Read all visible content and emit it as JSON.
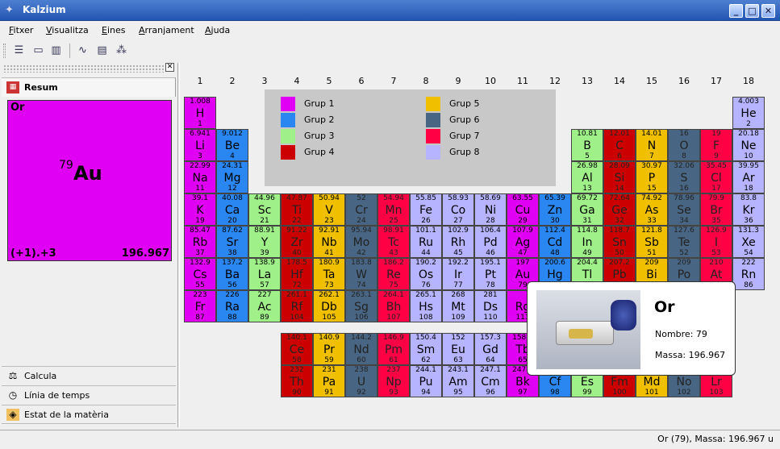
{
  "window": {
    "title": "Kalzium"
  },
  "menu": [
    "Fitxer",
    "Visualitza",
    "Eines",
    "Arranjament",
    "Ajuda"
  ],
  "toolbar": {
    "icons": [
      "list-icon",
      "card-icon",
      "column-icon",
      "wave-icon",
      "notebook-icon",
      "molecule-icon"
    ]
  },
  "sidebar": {
    "summary_tab": "Resum",
    "calc_tab": "Calcula",
    "timeline_tab": "Línia de temps",
    "state_tab": "Estat de la matèria"
  },
  "summary": {
    "name": "Or",
    "number": "79",
    "symbol": "Au",
    "oxidation": "(+1).+3",
    "mass": "196.967"
  },
  "groups": [
    "1",
    "2",
    "3",
    "4",
    "5",
    "6",
    "7",
    "8",
    "9",
    "10",
    "11",
    "12",
    "13",
    "14",
    "15",
    "16",
    "17",
    "18"
  ],
  "legend": [
    "Grup 1",
    "Grup 2",
    "Grup 3",
    "Grup 4",
    "Grup 5",
    "Grup 6",
    "Grup 7",
    "Grup 8"
  ],
  "group_colors": {
    "1": "#e000f4",
    "2": "#2a86f0",
    "3": "#a0f08a",
    "4": "#cc0000",
    "5": "#f0c000",
    "6": "#486683",
    "7": "#ff0044",
    "8": "#b7b4ff"
  },
  "elements": [
    {
      "s": "H",
      "n": "1",
      "m": "1.008",
      "g": "1",
      "x": 1,
      "y": 1
    },
    {
      "s": "He",
      "n": "2",
      "m": "4.003",
      "g": "8",
      "x": 18,
      "y": 1
    },
    {
      "s": "Li",
      "n": "3",
      "m": "6.941",
      "g": "1",
      "x": 1,
      "y": 2
    },
    {
      "s": "Be",
      "n": "4",
      "m": "9.012",
      "g": "2",
      "x": 2,
      "y": 2
    },
    {
      "s": "B",
      "n": "5",
      "m": "10.81",
      "g": "3",
      "x": 13,
      "y": 2
    },
    {
      "s": "C",
      "n": "6",
      "m": "12.01",
      "g": "4",
      "x": 14,
      "y": 2
    },
    {
      "s": "N",
      "n": "7",
      "m": "14.01",
      "g": "5",
      "x": 15,
      "y": 2
    },
    {
      "s": "O",
      "n": "8",
      "m": "16",
      "g": "6",
      "x": 16,
      "y": 2
    },
    {
      "s": "F",
      "n": "9",
      "m": "19",
      "g": "7",
      "x": 17,
      "y": 2
    },
    {
      "s": "Ne",
      "n": "10",
      "m": "20.18",
      "g": "8",
      "x": 18,
      "y": 2
    },
    {
      "s": "Na",
      "n": "11",
      "m": "22.99",
      "g": "1",
      "x": 1,
      "y": 3
    },
    {
      "s": "Mg",
      "n": "12",
      "m": "24.31",
      "g": "2",
      "x": 2,
      "y": 3
    },
    {
      "s": "Al",
      "n": "13",
      "m": "26.98",
      "g": "3",
      "x": 13,
      "y": 3
    },
    {
      "s": "Si",
      "n": "14",
      "m": "28.09",
      "g": "4",
      "x": 14,
      "y": 3
    },
    {
      "s": "P",
      "n": "15",
      "m": "30.97",
      "g": "5",
      "x": 15,
      "y": 3
    },
    {
      "s": "S",
      "n": "16",
      "m": "32.06",
      "g": "6",
      "x": 16,
      "y": 3
    },
    {
      "s": "Cl",
      "n": "17",
      "m": "35.45",
      "g": "7",
      "x": 17,
      "y": 3
    },
    {
      "s": "Ar",
      "n": "18",
      "m": "39.95",
      "g": "8",
      "x": 18,
      "y": 3
    },
    {
      "s": "K",
      "n": "19",
      "m": "39.1",
      "g": "1",
      "x": 1,
      "y": 4
    },
    {
      "s": "Ca",
      "n": "20",
      "m": "40.08",
      "g": "2",
      "x": 2,
      "y": 4
    },
    {
      "s": "Sc",
      "n": "21",
      "m": "44.96",
      "g": "3",
      "x": 3,
      "y": 4
    },
    {
      "s": "Ti",
      "n": "22",
      "m": "47.87",
      "g": "4",
      "x": 4,
      "y": 4
    },
    {
      "s": "V",
      "n": "23",
      "m": "50.94",
      "g": "5",
      "x": 5,
      "y": 4
    },
    {
      "s": "Cr",
      "n": "24",
      "m": "52",
      "g": "6",
      "x": 6,
      "y": 4
    },
    {
      "s": "Mn",
      "n": "25",
      "m": "54.94",
      "g": "7",
      "x": 7,
      "y": 4
    },
    {
      "s": "Fe",
      "n": "26",
      "m": "55.85",
      "g": "8",
      "x": 8,
      "y": 4
    },
    {
      "s": "Co",
      "n": "27",
      "m": "58.93",
      "g": "8",
      "x": 9,
      "y": 4
    },
    {
      "s": "Ni",
      "n": "28",
      "m": "58.69",
      "g": "8",
      "x": 10,
      "y": 4
    },
    {
      "s": "Cu",
      "n": "29",
      "m": "63.55",
      "g": "1",
      "x": 11,
      "y": 4
    },
    {
      "s": "Zn",
      "n": "30",
      "m": "65.39",
      "g": "2",
      "x": 12,
      "y": 4
    },
    {
      "s": "Ga",
      "n": "31",
      "m": "69.72",
      "g": "3",
      "x": 13,
      "y": 4
    },
    {
      "s": "Ge",
      "n": "32",
      "m": "72.64",
      "g": "4",
      "x": 14,
      "y": 4
    },
    {
      "s": "As",
      "n": "33",
      "m": "74.92",
      "g": "5",
      "x": 15,
      "y": 4
    },
    {
      "s": "Se",
      "n": "34",
      "m": "78.96",
      "g": "6",
      "x": 16,
      "y": 4
    },
    {
      "s": "Br",
      "n": "35",
      "m": "79.9",
      "g": "7",
      "x": 17,
      "y": 4
    },
    {
      "s": "Kr",
      "n": "36",
      "m": "83.8",
      "g": "8",
      "x": 18,
      "y": 4
    },
    {
      "s": "Rb",
      "n": "37",
      "m": "85.47",
      "g": "1",
      "x": 1,
      "y": 5
    },
    {
      "s": "Sr",
      "n": "38",
      "m": "87.62",
      "g": "2",
      "x": 2,
      "y": 5
    },
    {
      "s": "Y",
      "n": "39",
      "m": "88.91",
      "g": "3",
      "x": 3,
      "y": 5
    },
    {
      "s": "Zr",
      "n": "40",
      "m": "91.22",
      "g": "4",
      "x": 4,
      "y": 5
    },
    {
      "s": "Nb",
      "n": "41",
      "m": "92.91",
      "g": "5",
      "x": 5,
      "y": 5
    },
    {
      "s": "Mo",
      "n": "42",
      "m": "95.94",
      "g": "6",
      "x": 6,
      "y": 5
    },
    {
      "s": "Tc",
      "n": "43",
      "m": "98.91",
      "g": "7",
      "x": 7,
      "y": 5
    },
    {
      "s": "Ru",
      "n": "44",
      "m": "101.1",
      "g": "8",
      "x": 8,
      "y": 5
    },
    {
      "s": "Rh",
      "n": "45",
      "m": "102.9",
      "g": "8",
      "x": 9,
      "y": 5
    },
    {
      "s": "Pd",
      "n": "46",
      "m": "106.4",
      "g": "8",
      "x": 10,
      "y": 5
    },
    {
      "s": "Ag",
      "n": "47",
      "m": "107.9",
      "g": "1",
      "x": 11,
      "y": 5
    },
    {
      "s": "Cd",
      "n": "48",
      "m": "112.4",
      "g": "2",
      "x": 12,
      "y": 5
    },
    {
      "s": "In",
      "n": "49",
      "m": "114.8",
      "g": "3",
      "x": 13,
      "y": 5
    },
    {
      "s": "Sn",
      "n": "50",
      "m": "118.7",
      "g": "4",
      "x": 14,
      "y": 5
    },
    {
      "s": "Sb",
      "n": "51",
      "m": "121.8",
      "g": "5",
      "x": 15,
      "y": 5
    },
    {
      "s": "Te",
      "n": "52",
      "m": "127.6",
      "g": "6",
      "x": 16,
      "y": 5
    },
    {
      "s": "I",
      "n": "53",
      "m": "126.9",
      "g": "7",
      "x": 17,
      "y": 5
    },
    {
      "s": "Xe",
      "n": "54",
      "m": "131.3",
      "g": "8",
      "x": 18,
      "y": 5
    },
    {
      "s": "Cs",
      "n": "55",
      "m": "132.9",
      "g": "1",
      "x": 1,
      "y": 6
    },
    {
      "s": "Ba",
      "n": "56",
      "m": "137.2",
      "g": "2",
      "x": 2,
      "y": 6
    },
    {
      "s": "La",
      "n": "57",
      "m": "138.9",
      "g": "3",
      "x": 3,
      "y": 6
    },
    {
      "s": "Hf",
      "n": "72",
      "m": "178.5",
      "g": "4",
      "x": 4,
      "y": 6
    },
    {
      "s": "Ta",
      "n": "73",
      "m": "180.9",
      "g": "5",
      "x": 5,
      "y": 6
    },
    {
      "s": "W",
      "n": "74",
      "m": "183.8",
      "g": "6",
      "x": 6,
      "y": 6
    },
    {
      "s": "Re",
      "n": "75",
      "m": "186.2",
      "g": "7",
      "x": 7,
      "y": 6
    },
    {
      "s": "Os",
      "n": "76",
      "m": "190.2",
      "g": "8",
      "x": 8,
      "y": 6
    },
    {
      "s": "Ir",
      "n": "77",
      "m": "192.2",
      "g": "8",
      "x": 9,
      "y": 6
    },
    {
      "s": "Pt",
      "n": "78",
      "m": "195.1",
      "g": "8",
      "x": 10,
      "y": 6
    },
    {
      "s": "Au",
      "n": "79",
      "m": "197",
      "g": "1",
      "x": 11,
      "y": 6
    },
    {
      "s": "Hg",
      "n": "80",
      "m": "200.6",
      "g": "2",
      "x": 12,
      "y": 6
    },
    {
      "s": "Tl",
      "n": "81",
      "m": "204.4",
      "g": "3",
      "x": 13,
      "y": 6
    },
    {
      "s": "Pb",
      "n": "82",
      "m": "207.2",
      "g": "4",
      "x": 14,
      "y": 6
    },
    {
      "s": "Bi",
      "n": "83",
      "m": "209",
      "g": "5",
      "x": 15,
      "y": 6
    },
    {
      "s": "Po",
      "n": "84",
      "m": "209",
      "g": "6",
      "x": 16,
      "y": 6
    },
    {
      "s": "At",
      "n": "85",
      "m": "210",
      "g": "7",
      "x": 17,
      "y": 6
    },
    {
      "s": "Rn",
      "n": "86",
      "m": "222",
      "g": "8",
      "x": 18,
      "y": 6
    },
    {
      "s": "Fr",
      "n": "87",
      "m": "223",
      "g": "1",
      "x": 1,
      "y": 7
    },
    {
      "s": "Ra",
      "n": "88",
      "m": "226",
      "g": "2",
      "x": 2,
      "y": 7
    },
    {
      "s": "Ac",
      "n": "89",
      "m": "227",
      "g": "3",
      "x": 3,
      "y": 7
    },
    {
      "s": "Rf",
      "n": "104",
      "m": "261.1",
      "g": "4",
      "x": 4,
      "y": 7
    },
    {
      "s": "Db",
      "n": "105",
      "m": "262.1",
      "g": "5",
      "x": 5,
      "y": 7
    },
    {
      "s": "Sg",
      "n": "106",
      "m": "263.1",
      "g": "6",
      "x": 6,
      "y": 7
    },
    {
      "s": "Bh",
      "n": "107",
      "m": "264.1",
      "g": "7",
      "x": 7,
      "y": 7
    },
    {
      "s": "Hs",
      "n": "108",
      "m": "265.1",
      "g": "8",
      "x": 8,
      "y": 7
    },
    {
      "s": "Mt",
      "n": "109",
      "m": "268",
      "g": "8",
      "x": 9,
      "y": 7
    },
    {
      "s": "Ds",
      "n": "110",
      "m": "281",
      "g": "8",
      "x": 10,
      "y": 7
    },
    {
      "s": "Rg",
      "n": "111",
      "m": "",
      "g": "1",
      "x": 11,
      "y": 7
    },
    {
      "s": "Ce",
      "n": "58",
      "m": "140.1",
      "g": "4",
      "x": 4,
      "y": 9
    },
    {
      "s": "Pr",
      "n": "59",
      "m": "140.9",
      "g": "5",
      "x": 5,
      "y": 9
    },
    {
      "s": "Nd",
      "n": "60",
      "m": "144.2",
      "g": "6",
      "x": 6,
      "y": 9
    },
    {
      "s": "Pm",
      "n": "61",
      "m": "146.9",
      "g": "7",
      "x": 7,
      "y": 9
    },
    {
      "s": "Sm",
      "n": "62",
      "m": "150.4",
      "g": "8",
      "x": 8,
      "y": 9
    },
    {
      "s": "Eu",
      "n": "63",
      "m": "152",
      "g": "8",
      "x": 9,
      "y": 9
    },
    {
      "s": "Gd",
      "n": "64",
      "m": "157.3",
      "g": "8",
      "x": 10,
      "y": 9
    },
    {
      "s": "Tb",
      "n": "65",
      "m": "158.9",
      "g": "1",
      "x": 11,
      "y": 9
    },
    {
      "s": "Th",
      "n": "90",
      "m": "232",
      "g": "4",
      "x": 4,
      "y": 10
    },
    {
      "s": "Pa",
      "n": "91",
      "m": "231",
      "g": "5",
      "x": 5,
      "y": 10
    },
    {
      "s": "U",
      "n": "92",
      "m": "238",
      "g": "6",
      "x": 6,
      "y": 10
    },
    {
      "s": "Np",
      "n": "93",
      "m": "237",
      "g": "7",
      "x": 7,
      "y": 10
    },
    {
      "s": "Pu",
      "n": "94",
      "m": "244.1",
      "g": "8",
      "x": 8,
      "y": 10
    },
    {
      "s": "Am",
      "n": "95",
      "m": "243.1",
      "g": "8",
      "x": 9,
      "y": 10
    },
    {
      "s": "Cm",
      "n": "96",
      "m": "247.1",
      "g": "8",
      "x": 10,
      "y": 10
    },
    {
      "s": "Bk",
      "n": "97",
      "m": "247.1",
      "g": "1",
      "x": 11,
      "y": 10
    },
    {
      "s": "Cf",
      "n": "98",
      "m": "",
      "g": "2",
      "x": 12,
      "y": 10
    },
    {
      "s": "Es",
      "n": "99",
      "m": "",
      "g": "3",
      "x": 13,
      "y": 10
    },
    {
      "s": "Fm",
      "n": "100",
      "m": "",
      "g": "4",
      "x": 14,
      "y": 10
    },
    {
      "s": "Md",
      "n": "101",
      "m": "",
      "g": "5",
      "x": 15,
      "y": 10
    },
    {
      "s": "No",
      "n": "102",
      "m": "",
      "g": "6",
      "x": 16,
      "y": 10
    },
    {
      "s": "Lr",
      "n": "103",
      "m": "",
      "g": "7",
      "x": 17,
      "y": 10
    }
  ],
  "tooltip": {
    "name": "Or",
    "number": "Nombre: 79",
    "mass": "Massa: 196.967"
  },
  "status": "Or (79), Massa: 196.967 u"
}
